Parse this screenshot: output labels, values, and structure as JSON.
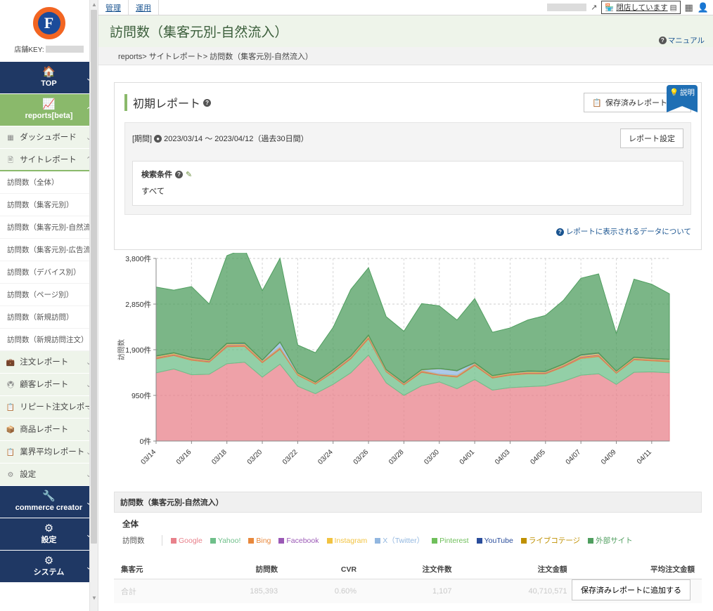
{
  "sidebar": {
    "logo_letter": "F",
    "shop_key_label": "店舗KEY:",
    "top": {
      "label": "TOP",
      "icon": "home-icon"
    },
    "reports": {
      "label": "reports[beta]",
      "icon": "chart-line-icon"
    },
    "menu": [
      {
        "label": "ダッシュボード",
        "icon": "dashboard-icon",
        "chev": "∨"
      },
      {
        "label": "サイトレポート",
        "icon": "site-report-icon",
        "chev": "∧"
      }
    ],
    "site_report_items": [
      "訪問数（全体）",
      "訪問数（集客元別）",
      "訪問数（集客元別-自然流入）",
      "訪問数（集客元別-広告流入）",
      "訪問数（デバイス別）",
      "訪問数（ページ別）",
      "訪問数（新規訪問）",
      "訪問数（新規訪問注文）"
    ],
    "menu2": [
      {
        "label": "注文レポート",
        "icon": "order-icon",
        "chev": "∨"
      },
      {
        "label": "顧客レポート",
        "icon": "customer-icon",
        "chev": "∨"
      },
      {
        "label": "リピート注文レポート",
        "icon": "repeat-icon",
        "chev": "∨"
      },
      {
        "label": "商品レポート",
        "icon": "product-icon",
        "chev": "∨"
      },
      {
        "label": "業界平均レポート",
        "icon": "industry-icon",
        "chev": "∨"
      },
      {
        "label": "設定",
        "icon": "settings-icon",
        "chev": "∨"
      }
    ],
    "bottom": [
      {
        "label": "commerce creator",
        "icon": "wrench-icon",
        "chev": "∨"
      },
      {
        "label": "設定",
        "icon": "gear-icon",
        "chev": "∨"
      },
      {
        "label": "システム",
        "icon": "gear-icon",
        "chev": "∨"
      }
    ]
  },
  "topbar": {
    "tabs": [
      "管理",
      "運用"
    ],
    "closed_label": "閉店しています",
    "grid_icon": "grid-icon",
    "user_icon": "user-icon",
    "link_icon": "external-link-icon",
    "shop_icon": "shop-icon",
    "toggle_icon": "toggle-icon"
  },
  "page": {
    "title": "訪問数（集客元別-自然流入）",
    "manual_label": "マニュアル",
    "breadcrumb": "reports> サイトレポート> 訪問数（集客元別-自然流入）",
    "explain_label": "説明"
  },
  "report": {
    "title": "初期レポート",
    "saved_report_button": "保存済みレポート呼出",
    "period_label": "[期間]",
    "period_value": "2023/03/14 〜 2023/04/12（過去30日間）",
    "settings_button": "レポート設定",
    "condition_title": "検索条件",
    "condition_value": "すべて",
    "data_note": "レポートに表示されるデータについて"
  },
  "chart_data": {
    "type": "area",
    "title": "訪問数（集客元別-自然流入）",
    "subtitle": "全体",
    "legend_key": "訪問数",
    "xlabel": "",
    "ylabel": "訪問数",
    "ylim": [
      0,
      3800
    ],
    "yticks": [
      0,
      950,
      1900,
      2850,
      3800
    ],
    "ytick_labels": [
      "0件",
      "950件",
      "1,900件",
      "2,850件",
      "3,800件"
    ],
    "grid": true,
    "legend_position": "bottom",
    "stacked": true,
    "x": [
      "03/14",
      "03/15",
      "03/16",
      "03/17",
      "03/18",
      "03/19",
      "03/20",
      "03/21",
      "03/22",
      "03/23",
      "03/24",
      "03/25",
      "03/26",
      "03/27",
      "03/28",
      "03/29",
      "03/30",
      "03/31",
      "04/01",
      "04/02",
      "04/03",
      "04/04",
      "04/05",
      "04/06",
      "04/07",
      "04/08",
      "04/09",
      "04/10",
      "04/11",
      "04/12"
    ],
    "xticks": [
      "03/14",
      "03/16",
      "03/18",
      "03/20",
      "03/22",
      "03/24",
      "03/26",
      "03/28",
      "03/30",
      "04/01",
      "04/03",
      "04/05",
      "04/07",
      "04/09",
      "04/11"
    ],
    "series": [
      {
        "name": "Google",
        "color": "#e8818b",
        "values": [
          1420,
          1500,
          1380,
          1390,
          1610,
          1640,
          1330,
          1600,
          1140,
          985,
          1180,
          1420,
          1790,
          1210,
          950,
          1150,
          1230,
          1090,
          1280,
          1060,
          1110,
          1130,
          1150,
          1240,
          1370,
          1400,
          1180,
          1430,
          1440,
          1420
        ]
      },
      {
        "name": "Yahoo!",
        "color": "#6fbf8a",
        "values": [
          290,
          280,
          300,
          250,
          350,
          330,
          300,
          310,
          230,
          200,
          250,
          290,
          340,
          230,
          220,
          280,
          140,
          240,
          290,
          250,
          260,
          270,
          250,
          300,
          350,
          360,
          230,
          260,
          230,
          230
        ]
      },
      {
        "name": "Bing",
        "color": "#e8883c",
        "values": [
          22,
          20,
          22,
          18,
          26,
          24,
          20,
          22,
          16,
          14,
          18,
          22,
          26,
          16,
          15,
          20,
          12,
          18,
          22,
          18,
          18,
          20,
          18,
          22,
          26,
          26,
          16,
          20,
          18,
          18
        ]
      },
      {
        "name": "Facebook",
        "color": "#9b59b6",
        "values": [
          10,
          9,
          10,
          8,
          12,
          11,
          9,
          10,
          7,
          6,
          8,
          10,
          12,
          7,
          7,
          9,
          5,
          8,
          10,
          8,
          8,
          9,
          8,
          10,
          12,
          12,
          7,
          9,
          8,
          8
        ]
      },
      {
        "name": "Instagram",
        "color": "#f2c341",
        "values": [
          18,
          17,
          18,
          15,
          20,
          19,
          16,
          18,
          13,
          11,
          14,
          17,
          20,
          13,
          12,
          16,
          9,
          14,
          17,
          14,
          14,
          15,
          14,
          17,
          20,
          20,
          13,
          15,
          14,
          14
        ]
      },
      {
        "name": "X（Twitter）",
        "color": "#92b7e0",
        "values": [
          6,
          5,
          6,
          5,
          8,
          7,
          5,
          95,
          6,
          5,
          6,
          7,
          8,
          5,
          5,
          6,
          110,
          90,
          6,
          5,
          5,
          6,
          5,
          6,
          8,
          8,
          5,
          6,
          5,
          5
        ]
      },
      {
        "name": "Pinterest",
        "color": "#6fbf5b",
        "values": [
          4,
          4,
          4,
          3,
          5,
          5,
          4,
          4,
          3,
          3,
          4,
          4,
          5,
          3,
          3,
          4,
          3,
          4,
          4,
          4,
          4,
          4,
          4,
          4,
          5,
          5,
          3,
          4,
          4,
          4
        ]
      },
      {
        "name": "YouTube",
        "color": "#2a4d9b",
        "values": [
          3,
          3,
          3,
          2,
          4,
          4,
          3,
          3,
          2,
          2,
          3,
          3,
          4,
          2,
          2,
          3,
          2,
          3,
          3,
          3,
          3,
          3,
          3,
          3,
          4,
          4,
          2,
          3,
          3,
          3
        ]
      },
      {
        "name": "ライブコテージ",
        "color": "#bf9000",
        "values": [
          2,
          2,
          2,
          2,
          3,
          3,
          2,
          2,
          2,
          2,
          2,
          2,
          3,
          2,
          2,
          2,
          2,
          2,
          2,
          2,
          2,
          2,
          2,
          2,
          3,
          3,
          2,
          2,
          2,
          2
        ]
      },
      {
        "name": "外部サイト",
        "color": "#4f9e5f",
        "values": [
          1430,
          1300,
          1470,
          1160,
          1820,
          1960,
          1440,
          1740,
          580,
          610,
          880,
          1380,
          1400,
          1100,
          1070,
          1370,
          1300,
          1050,
          1330,
          900,
          930,
          1060,
          1160,
          1320,
          1590,
          1640,
          780,
          1620,
          1540,
          1360
        ]
      }
    ]
  },
  "table": {
    "headers": [
      "集客元",
      "訪問数",
      "CVR",
      "注文件数",
      "注文金額",
      "平均注文金額"
    ],
    "rows": [
      {
        "cells": [
          "合計",
          "185,393",
          "0.60%",
          "1,107",
          "40,710,571",
          ""
        ]
      }
    ],
    "add_button": "保存済みレポートに追加する"
  }
}
